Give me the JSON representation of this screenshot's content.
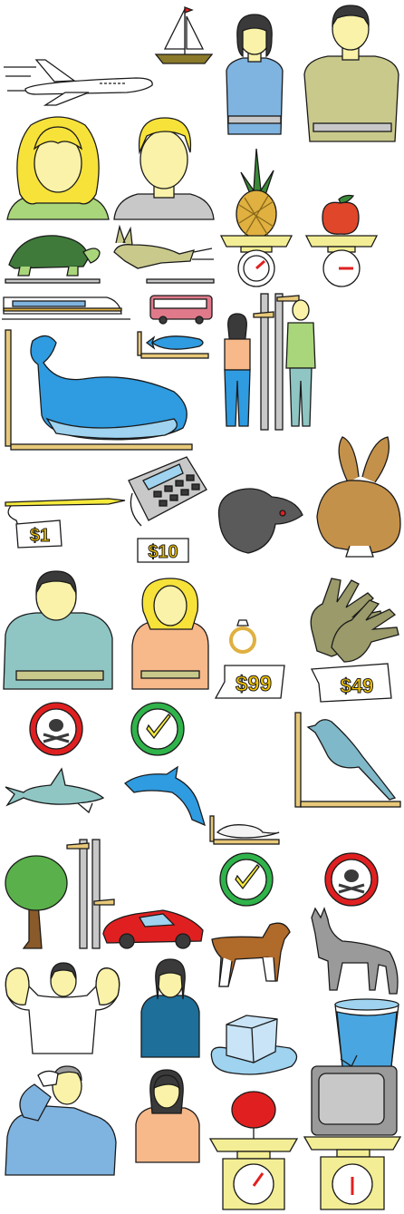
{
  "price_tags": {
    "pencil": "$1",
    "calculator": "$10",
    "ring": "$99",
    "gloves": "$49"
  },
  "colors": {
    "outline": "#1a1a1a",
    "skin": "#f9f2a8",
    "hair_blonde": "#f7e23a",
    "hair_dark": "#3a3a3a",
    "shirt_blue": "#7fb3e0",
    "shirt_khaki": "#c9c98c",
    "shirt_peach": "#f7b88a",
    "shirt_green": "#a9d67a",
    "shirt_gray": "#c8c8c8",
    "shirt_teal": "#1e6f9a",
    "shirt_sea": "#8fc6c4",
    "whale": "#2f9be0",
    "ruler": "#e8c97a",
    "price_yellow": "#f2c200",
    "danger_red": "#e02020",
    "ok_green": "#2fb34a",
    "ok_yellow": "#f5ea3c",
    "scale_yellow": "#f3ee95"
  },
  "icons": [
    "airplane-icon",
    "sailboat-icon",
    "woman-measuring-icon",
    "man-measuring-icon",
    "blonde-woman-icon",
    "blonde-man-icon",
    "pineapple-on-scale-icon",
    "apple-on-scale-icon",
    "turtle-icon",
    "hare-icon",
    "train-icon",
    "bus-icon",
    "whale-icon",
    "fish-icon",
    "height-comparison-icon",
    "pencil-icon",
    "calculator-icon",
    "rat-icon",
    "rabbit-icon",
    "heavy-man-icon",
    "slim-woman-icon",
    "ring-icon",
    "gloves-icon",
    "poison-icon",
    "check-icon",
    "bird-icon",
    "shark-icon",
    "dolphin-icon",
    "mouse-icon",
    "tree-icon",
    "car-icon",
    "dog-icon",
    "coyote-icon",
    "muscle-man-icon",
    "teal-woman-icon",
    "ice-cube-icon",
    "water-glass-icon",
    "sweating-man-icon",
    "peach-woman-icon",
    "balloon-on-scale-icon",
    "tv-on-scale-icon"
  ]
}
